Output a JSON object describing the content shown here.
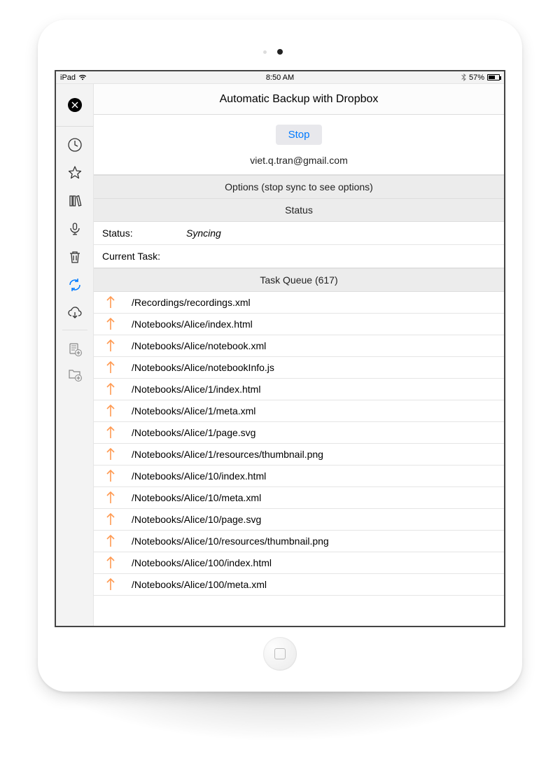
{
  "statusbar": {
    "device": "iPad",
    "time": "8:50 AM",
    "battery_pct": "57%"
  },
  "page": {
    "title": "Automatic Backup with Dropbox",
    "stop_label": "Stop",
    "account_email": "viet.q.tran@gmail.com"
  },
  "sections": {
    "options_header": "Options (stop sync to see options)",
    "status_header": "Status",
    "task_queue_header": "Task Queue (617)"
  },
  "status": {
    "status_label": "Status:",
    "status_value": "Syncing",
    "current_task_label": "Current Task:",
    "current_task_value": ""
  },
  "task_queue_count": 617,
  "queue": [
    "/Recordings/recordings.xml",
    "/Notebooks/Alice/index.html",
    "/Notebooks/Alice/notebook.xml",
    "/Notebooks/Alice/notebookInfo.js",
    "/Notebooks/Alice/1/index.html",
    "/Notebooks/Alice/1/meta.xml",
    "/Notebooks/Alice/1/page.svg",
    "/Notebooks/Alice/1/resources/thumbnail.png",
    "/Notebooks/Alice/10/index.html",
    "/Notebooks/Alice/10/meta.xml",
    "/Notebooks/Alice/10/page.svg",
    "/Notebooks/Alice/10/resources/thumbnail.png",
    "/Notebooks/Alice/100/index.html",
    "/Notebooks/Alice/100/meta.xml"
  ],
  "sidebar": {
    "close": "close",
    "items": [
      {
        "name": "recent",
        "icon": "clock"
      },
      {
        "name": "starred",
        "icon": "star"
      },
      {
        "name": "library",
        "icon": "books"
      },
      {
        "name": "recordings",
        "icon": "mic"
      },
      {
        "name": "trash",
        "icon": "trash"
      },
      {
        "name": "sync",
        "icon": "sync",
        "active": true
      },
      {
        "name": "cloud",
        "icon": "cloud-download"
      }
    ],
    "footer": [
      {
        "name": "new-note",
        "icon": "note-plus"
      },
      {
        "name": "new-folder",
        "icon": "folder-plus"
      }
    ]
  }
}
